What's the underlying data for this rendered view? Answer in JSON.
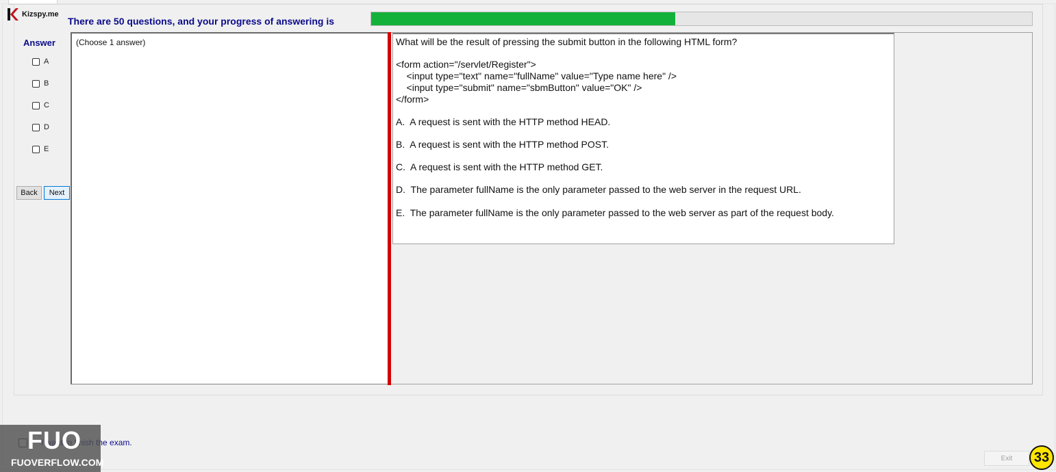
{
  "app": {
    "logo_text": "Kizspy.me"
  },
  "header": {
    "title": "There are 50 questions, and your progress of answering is",
    "progress_percent": 46
  },
  "answer_panel": {
    "label": "Answer",
    "options": [
      "A",
      "B",
      "C",
      "D",
      "E"
    ],
    "back_label": "Back",
    "next_label": "Next"
  },
  "left_pane": {
    "instruction": "(Choose 1 answer)"
  },
  "question": {
    "prompt": "What will be the result of pressing the submit button in the following HTML form?",
    "code": [
      "<form action=\"/servlet/Register\">",
      "    <input type=\"text\" name=\"fullName\" value=\"Type name here\" />",
      "    <input type=\"submit\" name=\"sbmButton\" value=\"OK\" />",
      "</form>"
    ],
    "choices": [
      "A.  A request is sent with the HTTP method HEAD.",
      "B.  A request is sent with the HTTP method POST.",
      "C.  A request is sent with the HTTP method GET.",
      "D.  The parameter fullName is the only parameter passed to the web server in the request URL.",
      "E.  The parameter fullName is the only parameter passed to the web server as part of the request body."
    ]
  },
  "footer": {
    "finish_label": "I want to finish the exam.",
    "exit_label": "Exit",
    "question_number": "33"
  },
  "watermark": {
    "big": "FUO",
    "small": "FUOVERFLOW.COM"
  },
  "colors": {
    "progress": "#13b13a",
    "divider": "#d40000",
    "accent_text": "#0a0a8a",
    "badge": "#ffe600"
  }
}
